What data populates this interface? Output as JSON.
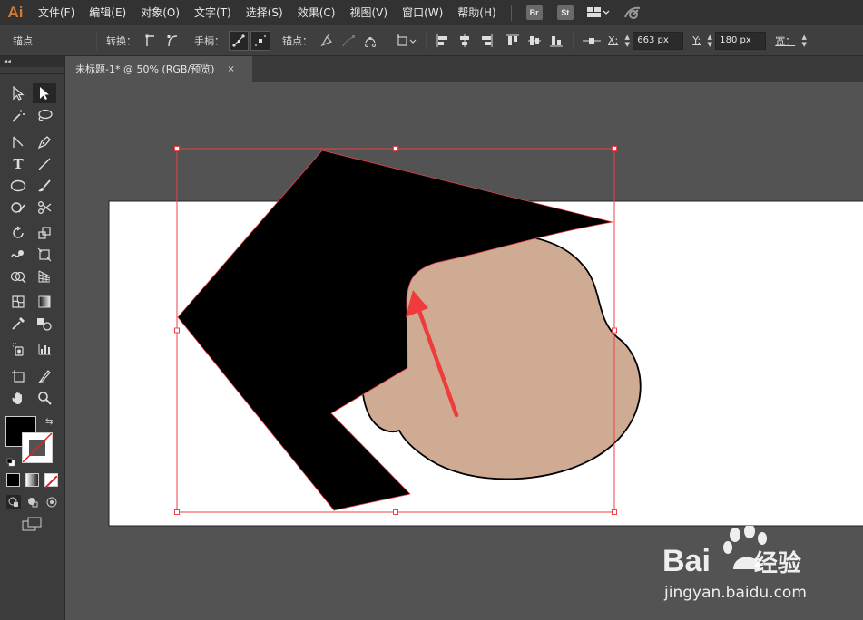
{
  "app": {
    "logo": "Ai"
  },
  "menu": {
    "items": [
      "文件(F)",
      "编辑(E)",
      "对象(O)",
      "文字(T)",
      "选择(S)",
      "效果(C)",
      "视图(V)",
      "窗口(W)",
      "帮助(H)"
    ],
    "badges": [
      "Br",
      "St"
    ]
  },
  "control": {
    "selection_label": "锚点",
    "convert_label": "转换：",
    "handles_label": "手柄：",
    "anchors_label": "锚点：",
    "x_label": "X:",
    "x_value": "663 px",
    "y_label": "Y:",
    "y_value": "180 px",
    "w_label": "宽："
  },
  "document": {
    "tab_title": "未标题-1* @ 50% (RGB/预览)",
    "tab_close": "×"
  },
  "toolbar": {
    "tools": [
      "selection-tool",
      "direct-selection-tool",
      "magic-wand-tool",
      "lasso-tool",
      "line-segment-tool",
      "pen-tool",
      "type-tool",
      "line-tool",
      "ellipse-tool",
      "paintbrush-tool",
      "shaper-tool",
      "scissors-tool",
      "rotate-tool",
      "scale-tool",
      "warp-tool",
      "free-transform-tool",
      "shape-builder-tool",
      "perspective-grid-tool",
      "mesh-tool",
      "gradient-tool",
      "eyedropper-tool",
      "blend-tool",
      "symbol-sprayer-tool",
      "column-graph-tool",
      "artboard-tool",
      "slice-tool",
      "hand-tool",
      "zoom-tool"
    ],
    "fill_color": "#000000",
    "stroke_color": "#ffffff"
  },
  "colors": {
    "accent_selection": "#e8434a",
    "face_fill": "#cfab93",
    "arrow": "#ef3b3b",
    "artboard": "#ffffff"
  },
  "watermark": {
    "brand": "Bai",
    "brand_suffix": "经验",
    "url": "jingyan.baidu.com"
  }
}
